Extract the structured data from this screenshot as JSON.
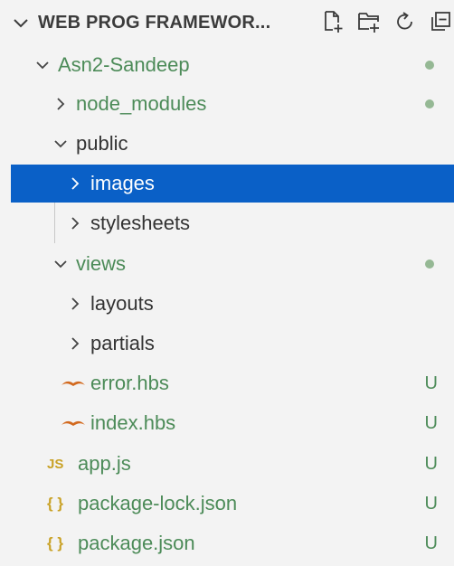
{
  "colors": {
    "selection": "#0a60c7",
    "git_untracked": "#4c8b58",
    "modified_dot": "#95b894",
    "hbs_icon": "#d2691e",
    "js_icon": "#c9a227",
    "json_icon": "#c9a227"
  },
  "header": {
    "title": "WEB PROG FRAMEWOR...",
    "actions": [
      {
        "icon": "new-file-icon"
      },
      {
        "icon": "new-folder-icon"
      },
      {
        "icon": "refresh-icon"
      },
      {
        "icon": "collapse-all-icon"
      }
    ]
  },
  "tree": {
    "root": {
      "label": "Asn2-Sandeep"
    },
    "node_modules": {
      "label": "node_modules"
    },
    "public": {
      "label": "public"
    },
    "images": {
      "label": "images"
    },
    "stylesheets": {
      "label": "stylesheets"
    },
    "views": {
      "label": "views"
    },
    "layouts": {
      "label": "layouts"
    },
    "partials": {
      "label": "partials"
    },
    "error_hbs": {
      "label": "error.hbs",
      "badge": "U"
    },
    "index_hbs": {
      "label": "index.hbs",
      "badge": "U"
    },
    "app_js": {
      "label": "app.js",
      "icon_text": "JS",
      "badge": "U"
    },
    "package_lock": {
      "label": "package-lock.json",
      "icon_text": "{ }",
      "badge": "U"
    },
    "package_json": {
      "label": "package.json",
      "icon_text": "{ }",
      "badge": "U"
    }
  }
}
